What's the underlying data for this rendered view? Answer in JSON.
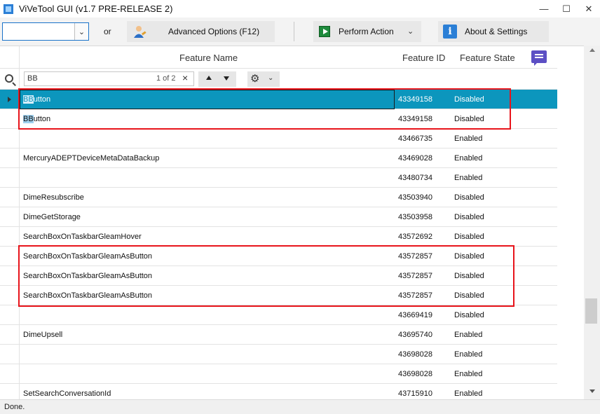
{
  "window": {
    "title": "ViVeTool GUI (v1.7 PRE-RELEASE 2)",
    "minimize": "—",
    "maximize": "☐",
    "close": "✕"
  },
  "toolbar": {
    "build_combo_value": "",
    "or_label": "or",
    "advanced_label": "Advanced Options (F12)",
    "perform_label": "Perform Action",
    "about_label": "About & Settings",
    "info_glyph": "i"
  },
  "grid": {
    "columns": {
      "name": "Feature Name",
      "id": "Feature ID",
      "state": "Feature State"
    },
    "search": {
      "value": "BB",
      "count": "1 of 2"
    },
    "rows": [
      {
        "name_hl": "BB",
        "name_rest": "utton",
        "id": "43349158",
        "state": "Disabled",
        "selected": true
      },
      {
        "name_hl": "BB",
        "name_rest": "utton",
        "id": "43349158",
        "state": "Disabled"
      },
      {
        "name_hl": "",
        "name_rest": "",
        "id": "43466735",
        "state": "Enabled"
      },
      {
        "name_hl": "",
        "name_rest": "MercuryADEPTDeviceMetaDataBackup",
        "id": "43469028",
        "state": "Enabled"
      },
      {
        "name_hl": "",
        "name_rest": "",
        "id": "43480734",
        "state": "Enabled"
      },
      {
        "name_hl": "",
        "name_rest": "DimeResubscribe",
        "id": "43503940",
        "state": "Disabled"
      },
      {
        "name_hl": "",
        "name_rest": "DimeGetStorage",
        "id": "43503958",
        "state": "Disabled"
      },
      {
        "name_hl": "",
        "name_rest": "SearchBoxOnTaskbarGleamHover",
        "id": "43572692",
        "state": "Disabled"
      },
      {
        "name_hl": "",
        "name_rest": "SearchBoxOnTaskbarGleamAsButton",
        "id": "43572857",
        "state": "Disabled"
      },
      {
        "name_hl": "",
        "name_rest": "SearchBoxOnTaskbarGleamAsButton",
        "id": "43572857",
        "state": "Disabled"
      },
      {
        "name_hl": "",
        "name_rest": "SearchBoxOnTaskbarGleamAsButton",
        "id": "43572857",
        "state": "Disabled"
      },
      {
        "name_hl": "",
        "name_rest": "",
        "id": "43669419",
        "state": "Disabled"
      },
      {
        "name_hl": "",
        "name_rest": "DimeUpsell",
        "id": "43695740",
        "state": "Enabled"
      },
      {
        "name_hl": "",
        "name_rest": "",
        "id": "43698028",
        "state": "Enabled"
      },
      {
        "name_hl": "",
        "name_rest": "",
        "id": "43698028",
        "state": "Enabled"
      },
      {
        "name_hl": "",
        "name_rest": "SetSearchConversationId",
        "id": "43715910",
        "state": "Enabled"
      }
    ]
  },
  "statusbar": {
    "text": "Done."
  },
  "colors": {
    "selection": "#0c96bd",
    "annotation_red": "#e8141b"
  }
}
